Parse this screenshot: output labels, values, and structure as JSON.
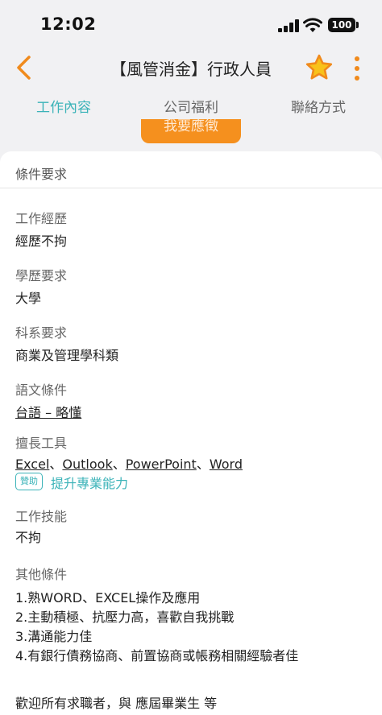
{
  "status_bar": {
    "time": "12:02",
    "battery": "100"
  },
  "header": {
    "title": "【風管消金】行政人員"
  },
  "tabs": [
    {
      "label": "工作內容",
      "active": true
    },
    {
      "label": "公司福利",
      "active": false
    },
    {
      "label": "聯絡方式",
      "active": false
    }
  ],
  "apply_button": {
    "label": "我要應徵"
  },
  "section": {
    "title": "條件要求"
  },
  "requirements": {
    "experience": {
      "label": "工作經歷",
      "value": "經歷不拘"
    },
    "education": {
      "label": "學歷要求",
      "value": "大學"
    },
    "major": {
      "label": "科系要求",
      "value": "商業及管理學科類"
    },
    "language": {
      "label": "語文條件",
      "value": "台語 –  略懂"
    },
    "tools": {
      "label": "擅長工具",
      "items": [
        "Excel",
        "Outlook",
        "PowerPoint",
        "Word"
      ],
      "separator": "、",
      "badge": "贊助",
      "promo": "提升專業能力"
    },
    "skills": {
      "label": "工作技能",
      "value": "不拘"
    },
    "other": {
      "label": "其他條件",
      "lines": [
        "1.熟WORD、EXCEL操作及應用",
        "2.主動積極、抗壓力高，喜歡自我挑戰",
        "3.溝通能力佳",
        "4.有銀行債務協商、前置協商或帳務相關經驗者佳"
      ]
    },
    "welcome": "歡迎所有求職者，與 應屆畢業生 等"
  },
  "colors": {
    "accent": "#3bb3b8",
    "brand": "#f5901e",
    "star": "#f08a1c"
  },
  "icons": {
    "back": "chevron-left-icon",
    "favorite": "star-icon",
    "more": "more-vertical-icon"
  }
}
